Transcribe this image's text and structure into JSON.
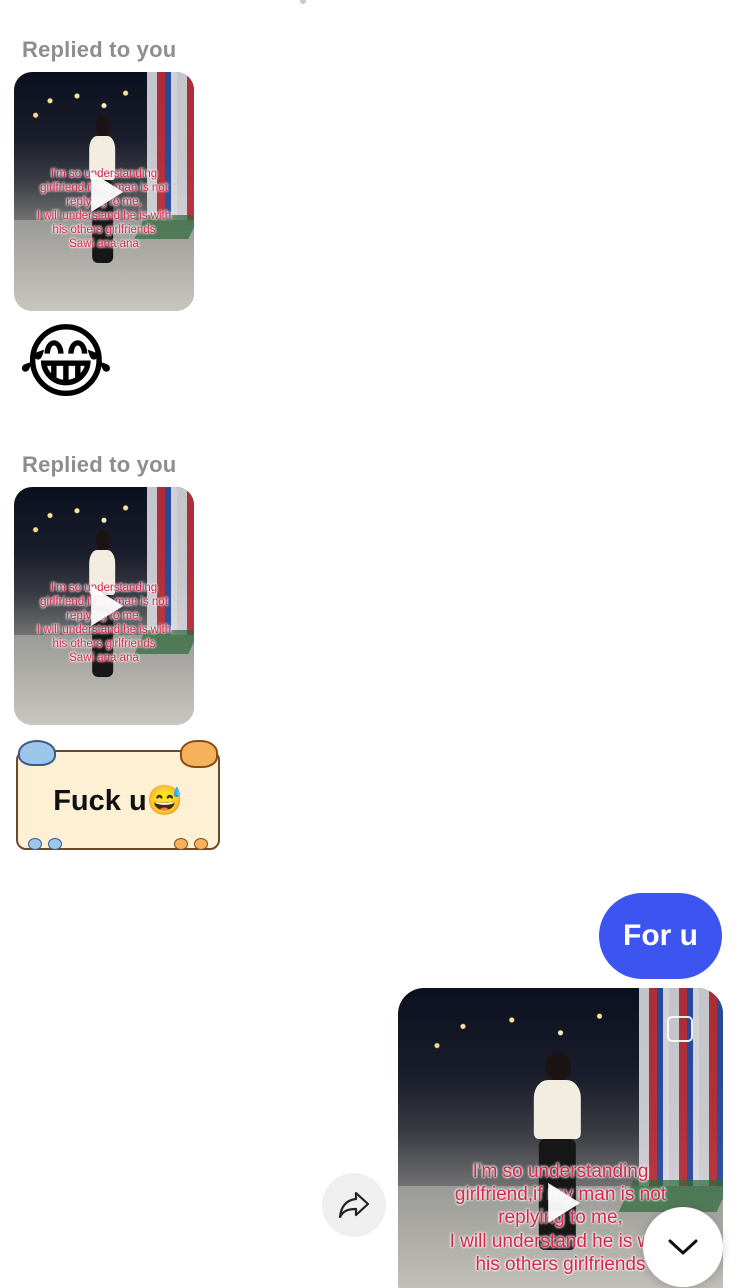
{
  "replies": [
    {
      "label": "Replied to you",
      "caption": "I'm so understanding\ngirlfriend,if my man is not\nreplying to me,\nI will understand he is with\nhis others girlfriends\nSawi ana ana"
    },
    {
      "label": "Replied to you",
      "caption": "I'm so understanding\ngirlfriend,if my man is not\nreplying to me,\nI will understand he is with\nhis others girlfriends\nSawi ana ana"
    }
  ],
  "reaction_emoji": "😂",
  "sticker": {
    "text": "Fuck u😅"
  },
  "my_message": {
    "text": "For u"
  },
  "my_video": {
    "caption": "I'm so understanding\ngirlfriend,if my man is not\nreplying to me,\nI will understand he is with\nhis others girlfriends"
  },
  "icons": {
    "share": "share-arrow-icon",
    "scroll": "chevron-down-icon",
    "play": "play-icon"
  },
  "colors": {
    "my_bubble": "#3d55f0",
    "label_gray": "#8e8e8e",
    "caption_red": "#d6264a"
  }
}
